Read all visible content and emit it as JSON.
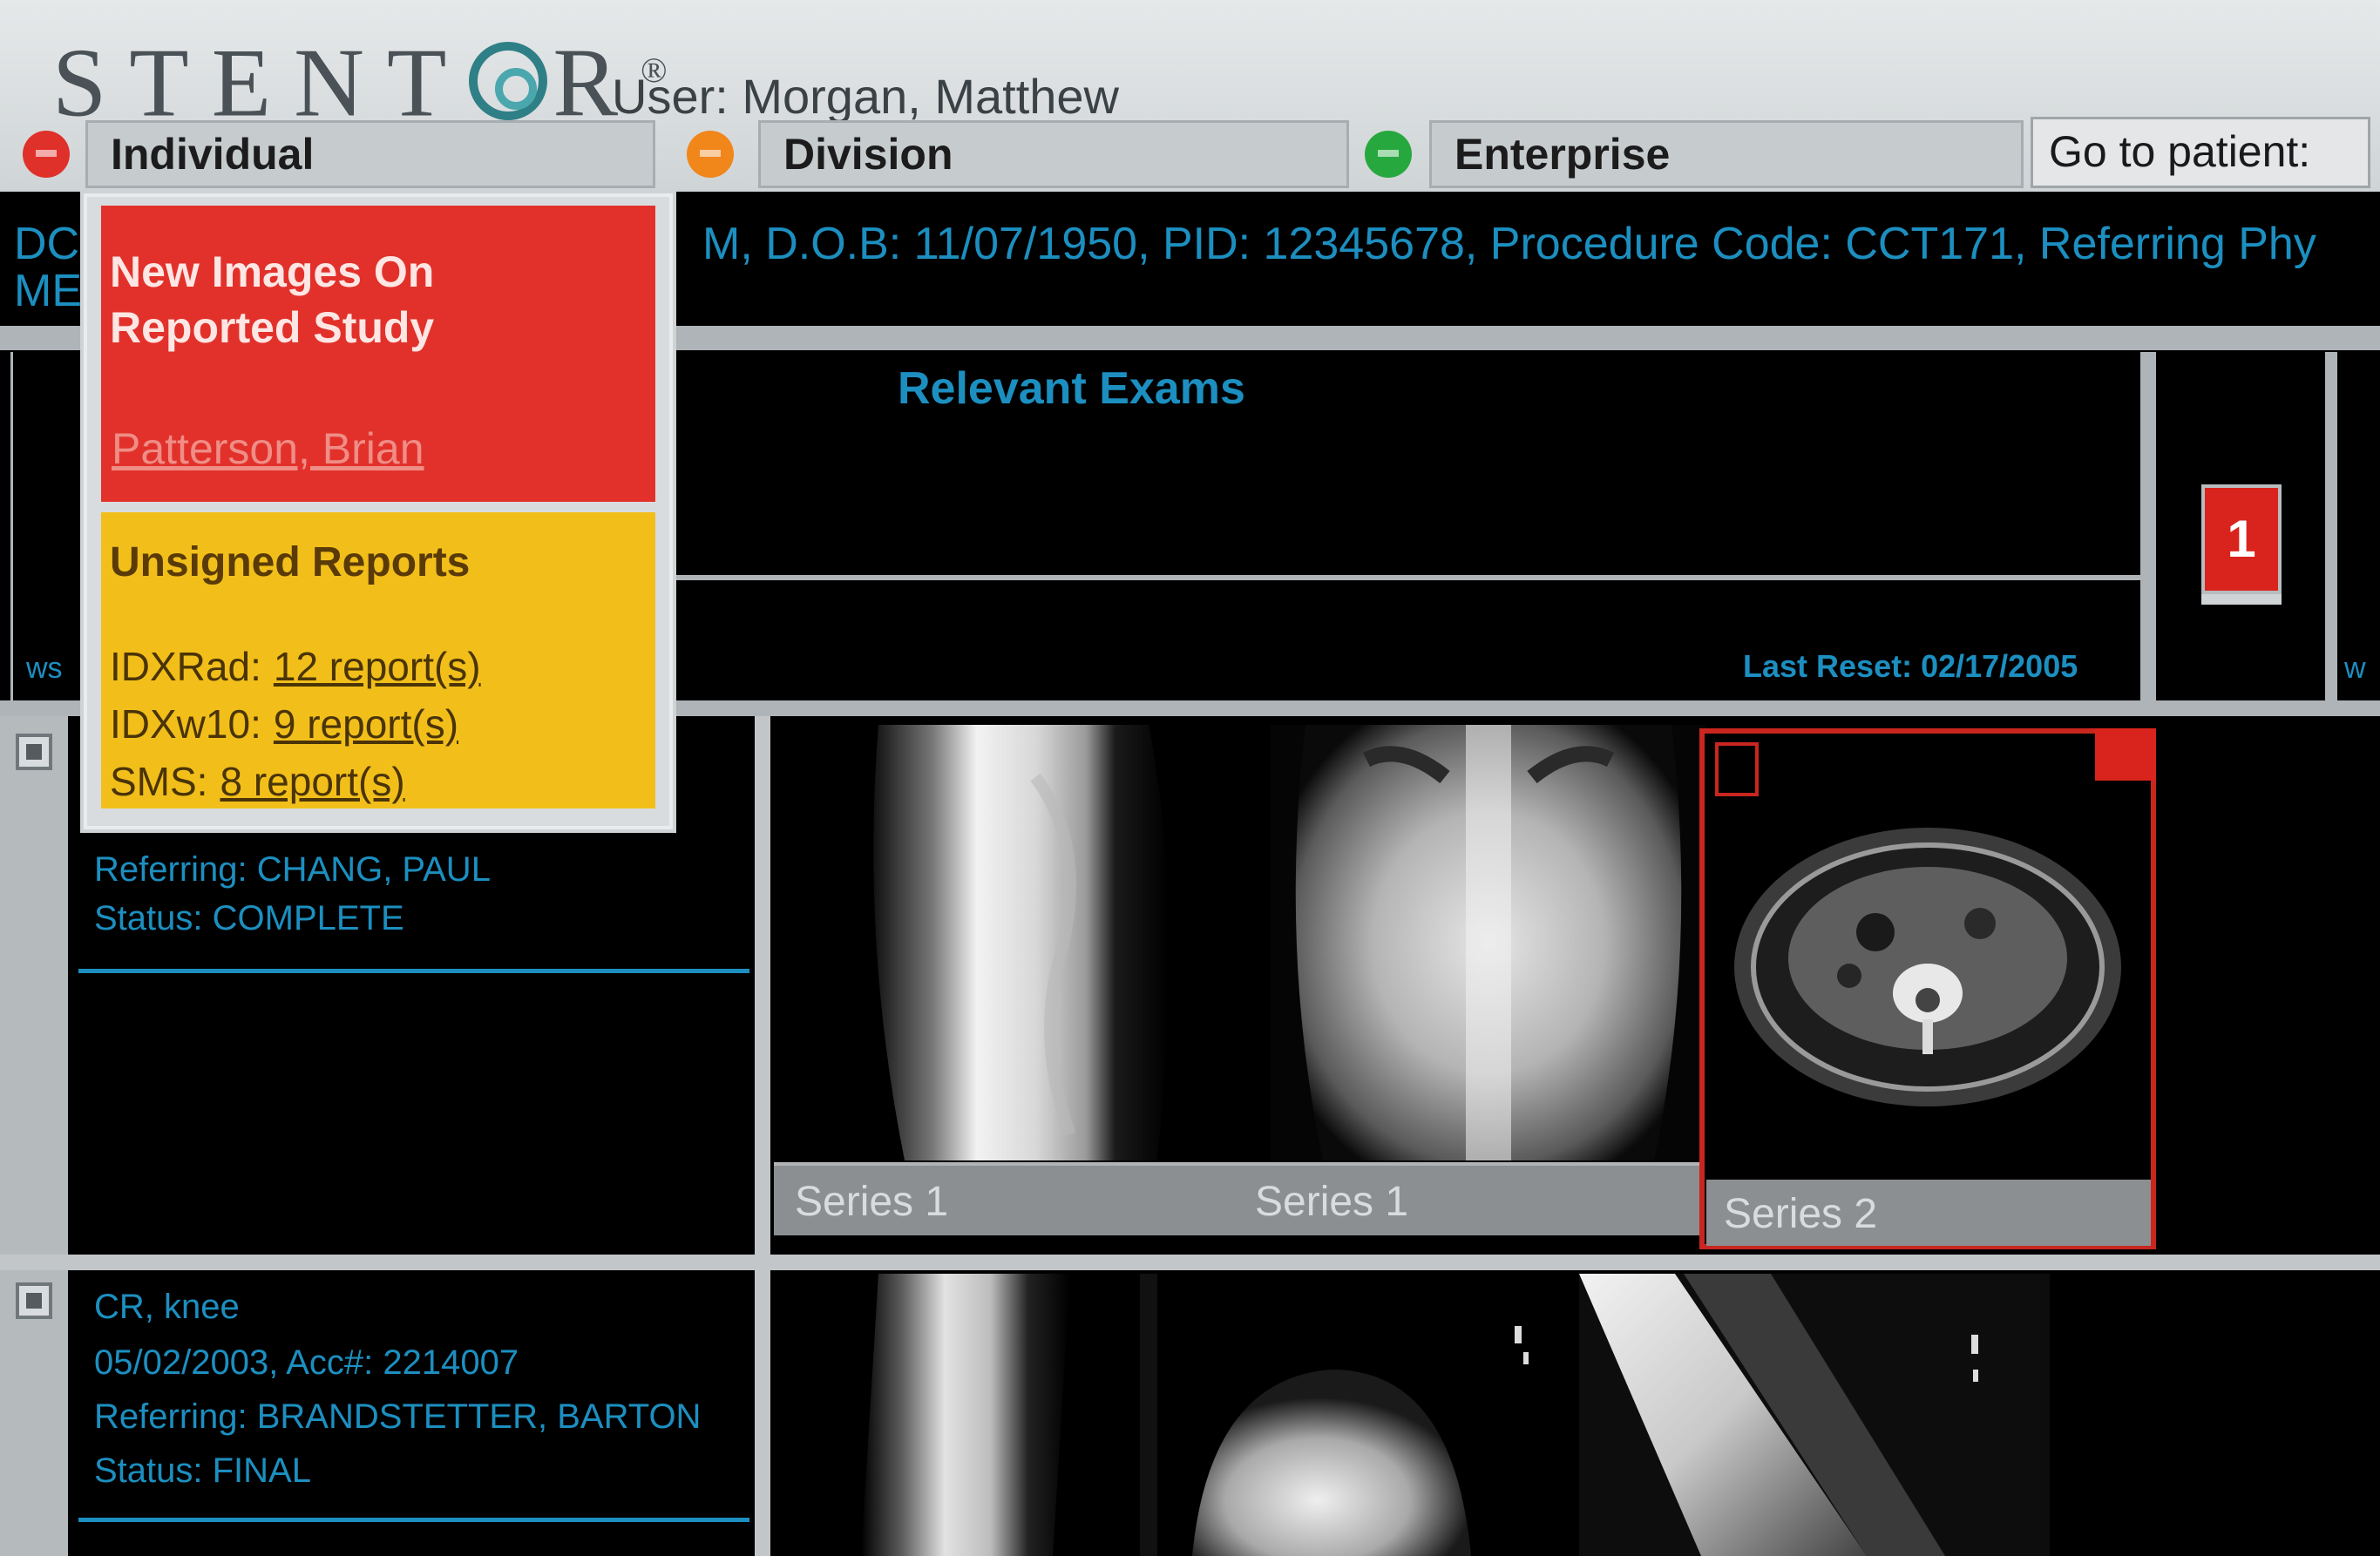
{
  "header": {
    "logo": "STENT",
    "logo_tail": "R",
    "logo_mark": "®",
    "user_label": "User: Morgan, Matthew"
  },
  "tabs": [
    {
      "label": "Individual",
      "color": "#e0302a"
    },
    {
      "label": "Division",
      "color": "#f1861b"
    },
    {
      "label": "Enterprise",
      "color": "#27a83e"
    }
  ],
  "goto_label": "Go to patient:",
  "patient": {
    "left_a": "DC",
    "left_b": "ME",
    "info": "M, D.O.B: 11/07/1950, PID: 12345678, Procedure Code: CCT171, Referring Phy"
  },
  "relevant_exams_title": "Relevant Exams",
  "last_reset": "Last Reset: 02/17/2005",
  "left_fragment": "ws",
  "right_fragment": "w",
  "relevant_count": "1",
  "alert": {
    "title": "New Images On Reported Study",
    "link": "Patterson, Brian"
  },
  "unsigned": {
    "title": "Unsigned Reports",
    "rows": [
      {
        "label": "IDXRad:",
        "link": "12 report(s)"
      },
      {
        "label": "IDXw10:",
        "link": "9 report(s)"
      },
      {
        "label": "SMS:",
        "link": "8 report(s)"
      }
    ]
  },
  "exam1": {
    "referring": "Referring: CHANG, PAUL",
    "status": "Status: COMPLETE"
  },
  "exam2": {
    "title": "CR, knee",
    "date": "05/02/2003, Acc#: 2214007",
    "referring": "Referring: BRANDSTETTER, BARTON",
    "status": "Status: FINAL"
  },
  "series": {
    "s1": "Series 1",
    "s2": "Series 1",
    "s3": "Series 2"
  }
}
